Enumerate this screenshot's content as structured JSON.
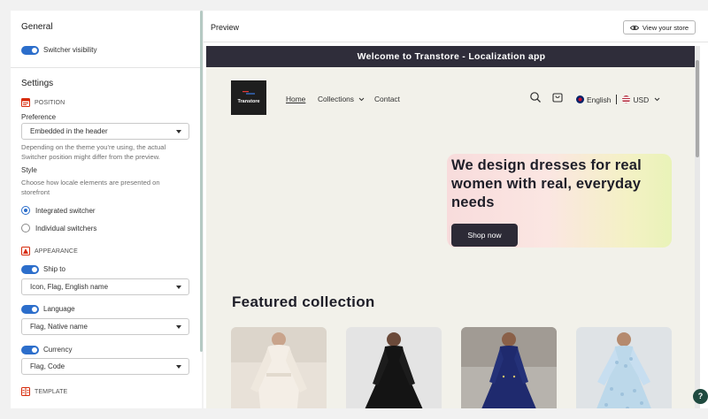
{
  "sidebar": {
    "general": {
      "heading": "General",
      "switcher_visibility": "Switcher visibility"
    },
    "settings": {
      "heading": "Settings",
      "position_label": "POSITION",
      "preference_label": "Preference",
      "preference_value": "Embedded in the header",
      "preference_help": "Depending on the theme you're using, the actual Switcher position might differ from the preview.",
      "style_label": "Style",
      "style_help": "Choose how locale elements are presented on storefront",
      "style_options": [
        "Integrated switcher",
        "Individual switchers"
      ],
      "style_selected": "Integrated switcher",
      "appearance_label": "APPEARANCE",
      "ship_to_label": "Ship to",
      "ship_to_value": "Icon, Flag, English name",
      "language_label": "Language",
      "language_value": "Flag, Native name",
      "currency_label": "Currency",
      "currency_value": "Flag, Code",
      "template_label": "TEMPLATE"
    }
  },
  "preview": {
    "title": "Preview",
    "view_store": "View your store",
    "store": {
      "announcement": "Welcome to Transtore - Localization app",
      "logo_text": "Transtore",
      "nav": [
        "Home",
        "Collections",
        "Contact"
      ],
      "language": "English",
      "currency": "USD",
      "hero_title": "We design dresses for real women with real, everyday needs",
      "shop_now": "Shop now",
      "featured_title": "Featured collection"
    }
  },
  "help_button": "?",
  "colors": {
    "accent": "#2c6ecb",
    "announcement_bg": "#2f2d3a",
    "store_bg": "#f2f1ea",
    "button_dark": "#2c2a36"
  }
}
